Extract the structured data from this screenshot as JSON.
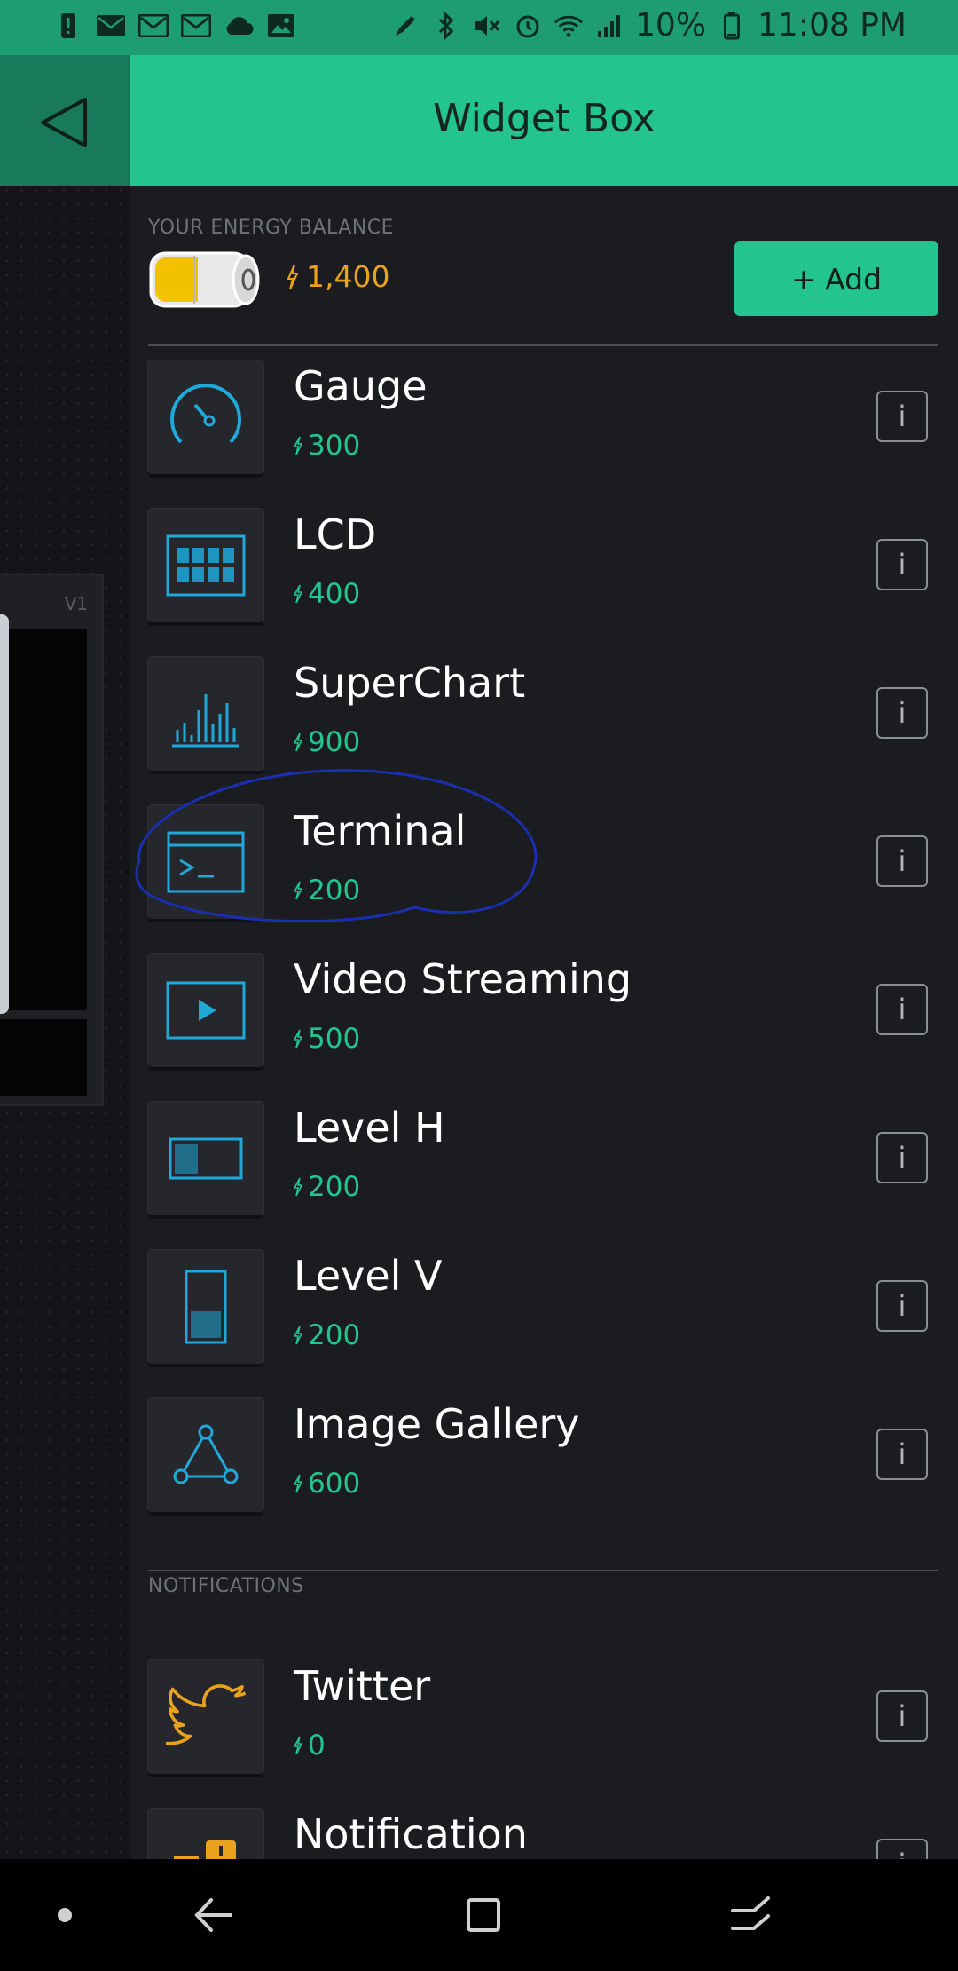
{
  "status_bar": {
    "battery_percent": "10%",
    "time": "11:08 PM",
    "left_icons": [
      "alert-icon",
      "mail-icon",
      "mail-icon",
      "mail-icon",
      "cloud-icon",
      "image-icon"
    ],
    "right_icons": [
      "pen-icon",
      "bluetooth-icon",
      "mute-icon",
      "alarm-icon",
      "wifi-icon",
      "signal-icon",
      "battery-icon"
    ]
  },
  "header": {
    "title": "Widget Box",
    "back_icon": "triangle-back-icon"
  },
  "energy": {
    "label": "YOUR ENERGY BALANCE",
    "value": "1,400",
    "add_label": "+ Add"
  },
  "widgets": [
    {
      "name": "Gauge",
      "cost": "300",
      "icon": "gauge-icon"
    },
    {
      "name": "LCD",
      "cost": "400",
      "icon": "lcd-icon"
    },
    {
      "name": "SuperChart",
      "cost": "900",
      "icon": "superchart-icon"
    },
    {
      "name": "Terminal",
      "cost": "200",
      "icon": "terminal-icon"
    },
    {
      "name": "Video Streaming",
      "cost": "500",
      "icon": "video-icon"
    },
    {
      "name": "Level H",
      "cost": "200",
      "icon": "level-h-icon"
    },
    {
      "name": "Level V",
      "cost": "200",
      "icon": "level-v-icon"
    },
    {
      "name": "Image Gallery",
      "cost": "600",
      "icon": "image-gallery-icon"
    }
  ],
  "notifications": {
    "label": "NOTIFICATIONS",
    "items": [
      {
        "name": "Twitter",
        "cost": "0",
        "icon": "twitter-icon"
      },
      {
        "name": "Notification",
        "cost": "",
        "icon": "notification-icon"
      }
    ]
  },
  "info_label": "i",
  "background_widget": {
    "pin_label": "V1"
  },
  "colors": {
    "accent": "#23c48e",
    "energy": "#e8a21c",
    "icon_blue": "#1fa8d8",
    "annotation": "#1a2fb0"
  },
  "nav_bar": {
    "icons": [
      "dot-icon",
      "back-arrow-icon",
      "recent-apps-icon",
      "menu-lines-icon"
    ]
  }
}
